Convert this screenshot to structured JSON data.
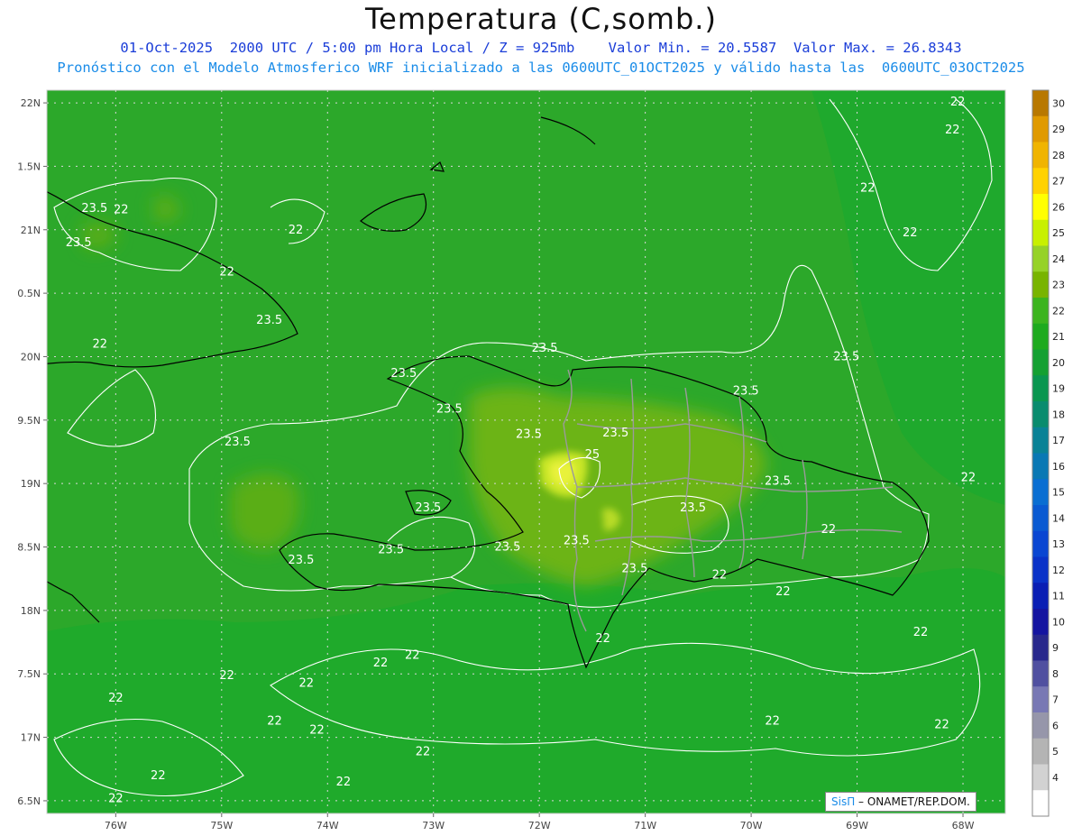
{
  "header": {
    "title": "Temperatura (C,somb.)",
    "line1": "01-Oct-2025  2000 UTC / 5:00 pm Hora Local / Z = 925mb    Valor Min. = 20.5587  Valor Max. = 26.8343",
    "line2": "Pronóstico con el Modelo Atmosferico WRF inicializado a las 0600UTC_01OCT2025 y válido hasta las  0600UTC_03OCT2025"
  },
  "map": {
    "lon_labels": [
      "76W",
      "75W",
      "74W",
      "73W",
      "72W",
      "71W",
      "70W",
      "69W",
      "68W"
    ],
    "lat_labels": [
      "22N",
      "1.5N",
      "21N",
      "0.5N",
      "20N",
      "9.5N",
      "19N",
      "8.5N",
      "18N",
      "7.5N",
      "17N",
      "6.5N"
    ],
    "contour_labels": [
      {
        "text": "22",
        "lon": -68.05,
        "lat": 21.98
      },
      {
        "text": "22",
        "lon": -68.1,
        "lat": 21.76
      },
      {
        "text": "22",
        "lon": -68.9,
        "lat": 21.3
      },
      {
        "text": "22",
        "lon": -68.5,
        "lat": 20.95
      },
      {
        "text": "23.5",
        "lon": -76.2,
        "lat": 21.14
      },
      {
        "text": "22",
        "lon": -75.95,
        "lat": 21.13
      },
      {
        "text": "23.5",
        "lon": -76.35,
        "lat": 20.87
      },
      {
        "text": "22",
        "lon": -74.3,
        "lat": 20.97
      },
      {
        "text": "22",
        "lon": -74.95,
        "lat": 20.64
      },
      {
        "text": "23.5",
        "lon": -74.55,
        "lat": 20.26
      },
      {
        "text": "22",
        "lon": -76.15,
        "lat": 20.07
      },
      {
        "text": "23.5",
        "lon": -71.95,
        "lat": 20.04
      },
      {
        "text": "23.5",
        "lon": -73.28,
        "lat": 19.84
      },
      {
        "text": "23.5",
        "lon": -69.1,
        "lat": 19.97
      },
      {
        "text": "23.5",
        "lon": -70.05,
        "lat": 19.7
      },
      {
        "text": "23.5",
        "lon": -72.85,
        "lat": 19.56
      },
      {
        "text": "23.5",
        "lon": -72.1,
        "lat": 19.36
      },
      {
        "text": "23.5",
        "lon": -71.28,
        "lat": 19.37
      },
      {
        "text": "25",
        "lon": -71.5,
        "lat": 19.2
      },
      {
        "text": "23.5",
        "lon": -74.85,
        "lat": 19.3
      },
      {
        "text": "23.5",
        "lon": -69.75,
        "lat": 18.99
      },
      {
        "text": "22",
        "lon": -67.95,
        "lat": 19.02
      },
      {
        "text": "23.5",
        "lon": -73.05,
        "lat": 18.78
      },
      {
        "text": "23.5",
        "lon": -70.55,
        "lat": 18.78
      },
      {
        "text": "22",
        "lon": -69.27,
        "lat": 18.61
      },
      {
        "text": "23.5",
        "lon": -71.65,
        "lat": 18.52
      },
      {
        "text": "23.5",
        "lon": -72.3,
        "lat": 18.47
      },
      {
        "text": "23.5",
        "lon": -73.4,
        "lat": 18.45
      },
      {
        "text": "23.5",
        "lon": -74.25,
        "lat": 18.37
      },
      {
        "text": "23.5",
        "lon": -71.1,
        "lat": 18.3
      },
      {
        "text": "22",
        "lon": -70.3,
        "lat": 18.25
      },
      {
        "text": "22",
        "lon": -69.7,
        "lat": 18.12
      },
      {
        "text": "22",
        "lon": -71.4,
        "lat": 17.75
      },
      {
        "text": "22",
        "lon": -68.4,
        "lat": 17.8
      },
      {
        "text": "22",
        "lon": -73.2,
        "lat": 17.62
      },
      {
        "text": "22",
        "lon": -73.5,
        "lat": 17.56
      },
      {
        "text": "22",
        "lon": -74.95,
        "lat": 17.46
      },
      {
        "text": "22",
        "lon": -74.2,
        "lat": 17.4
      },
      {
        "text": "22",
        "lon": -76.0,
        "lat": 17.28
      },
      {
        "text": "22",
        "lon": -74.5,
        "lat": 17.1
      },
      {
        "text": "22",
        "lon": -69.8,
        "lat": 17.1
      },
      {
        "text": "22",
        "lon": -74.1,
        "lat": 17.03
      },
      {
        "text": "22",
        "lon": -68.2,
        "lat": 17.07
      },
      {
        "text": "22",
        "lon": -73.1,
        "lat": 16.86
      },
      {
        "text": "22",
        "lon": -75.6,
        "lat": 16.67
      },
      {
        "text": "22",
        "lon": -73.85,
        "lat": 16.62
      },
      {
        "text": "22",
        "lon": -76.0,
        "lat": 16.49
      }
    ]
  },
  "colorbar": {
    "levels": [
      "30",
      "29",
      "28",
      "27",
      "26",
      "25",
      "24",
      "23",
      "22",
      "21",
      "20",
      "19",
      "18",
      "17",
      "16",
      "15",
      "14",
      "13",
      "12",
      "11",
      "10",
      "9",
      "8",
      "7",
      "6",
      "5",
      "4"
    ],
    "colors": [
      "#b87800",
      "#e09a00",
      "#f0b400",
      "#ffd200",
      "#ffff00",
      "#c8f000",
      "#96d228",
      "#78b400",
      "#3cb41e",
      "#1eaa1e",
      "#14a032",
      "#0a9650",
      "#0a8c6e",
      "#0a8296",
      "#0a78b4",
      "#0a6ed2",
      "#0a5ad2",
      "#0a46d2",
      "#0a32c8",
      "#0a1eb4",
      "#1414a0",
      "#28288c",
      "#5050a0",
      "#7878b4",
      "#9696aa",
      "#b4b4b4",
      "#d2d2d2",
      "#ffffff"
    ]
  },
  "credit": {
    "brand": "SisΠ",
    "text": " – ONAMET/REP.DOM."
  }
}
